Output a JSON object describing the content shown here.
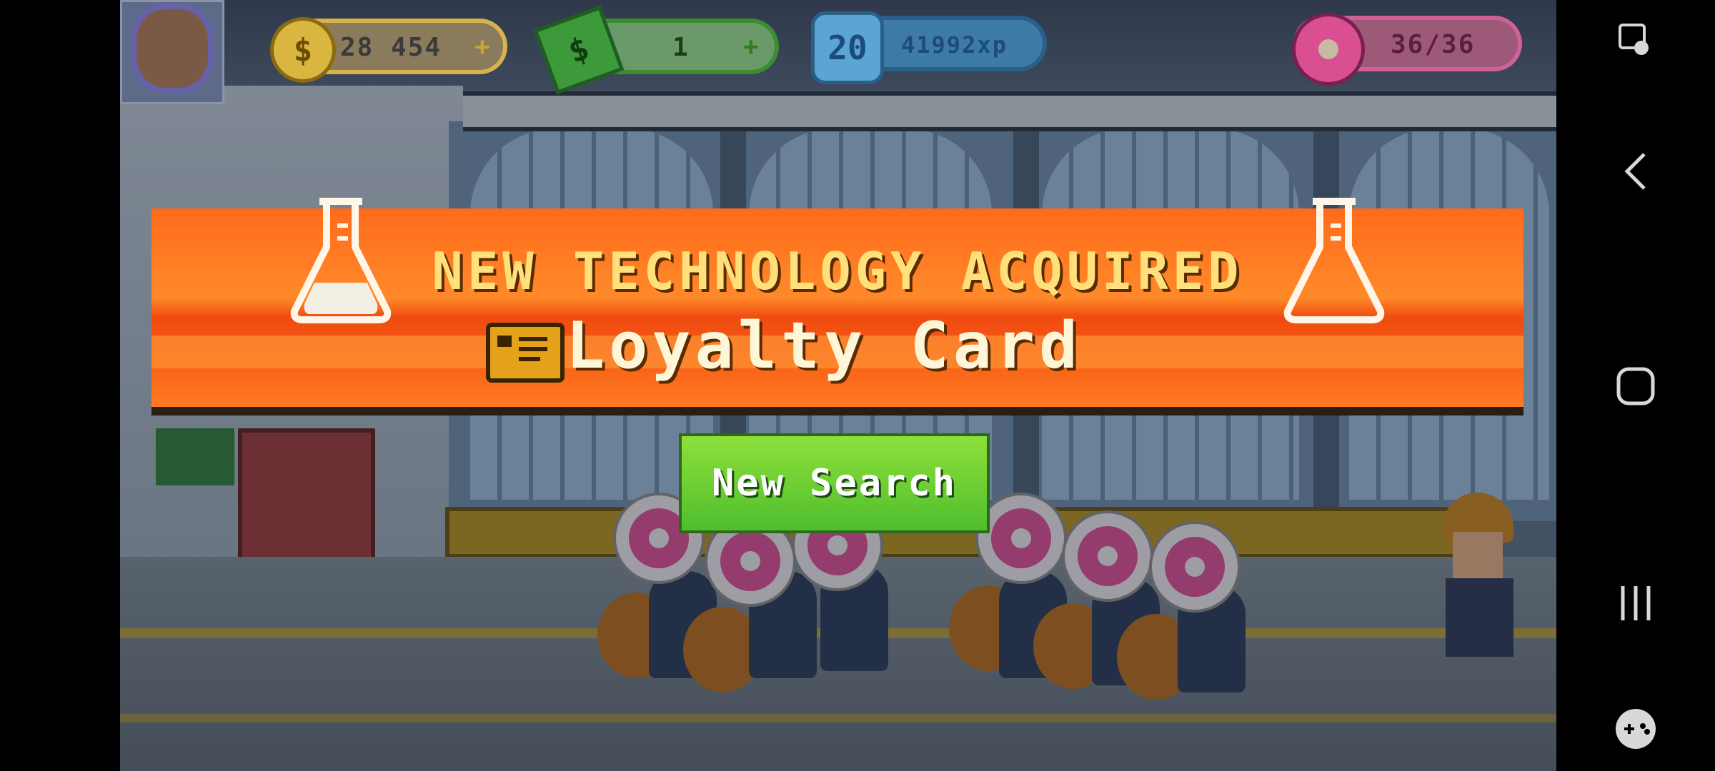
{
  "hud": {
    "coins": "28 454",
    "coins_plus": "+",
    "cash": "1",
    "cash_plus": "+",
    "level": "20",
    "xp": "41992xp",
    "donuts": "36/36"
  },
  "banner": {
    "title": "NEW TECHNOLOGY ACQUIRED",
    "item": "Loyalty Card"
  },
  "button": {
    "new_search": "New Search"
  },
  "nav": {
    "icons": [
      "screen-lock-icon",
      "back-icon",
      "home-icon",
      "recents-icon",
      "gamepad-icon"
    ]
  }
}
